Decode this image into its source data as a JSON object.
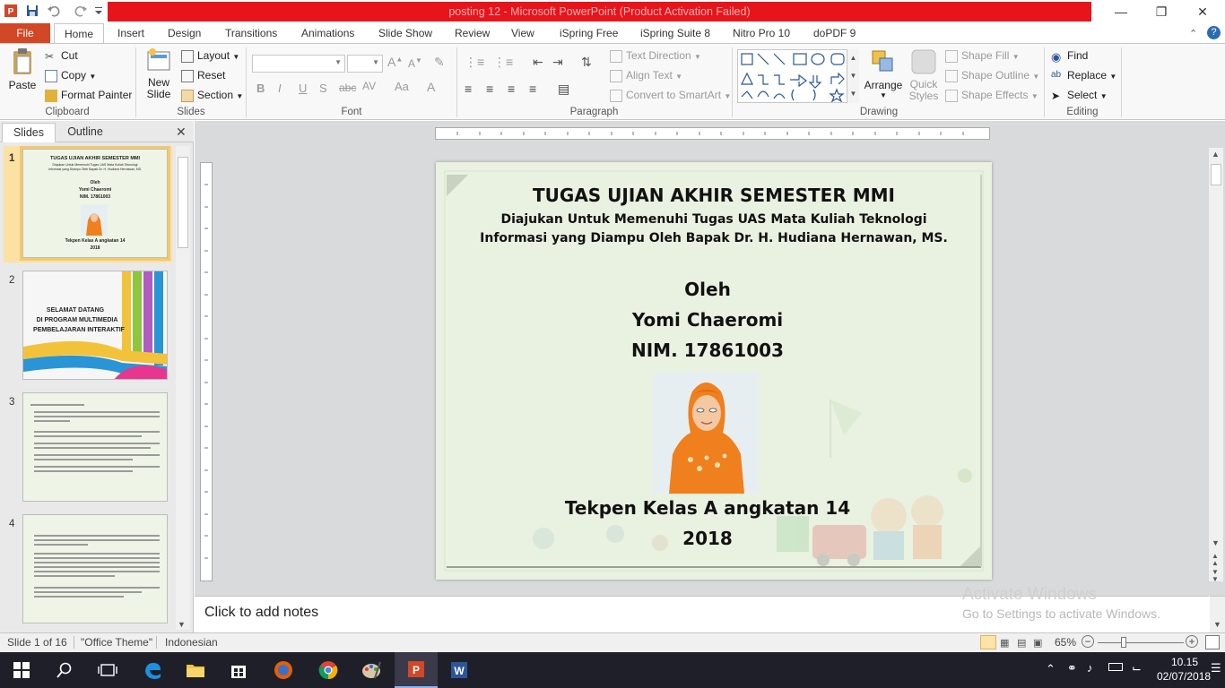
{
  "window": {
    "title": "posting 12 - Microsoft PowerPoint (Product Activation Failed)"
  },
  "tabs": [
    "File",
    "Home",
    "Insert",
    "Design",
    "Transitions",
    "Animations",
    "Slide Show",
    "Review",
    "View",
    "iSpring Free",
    "iSpring Suite 8",
    "Nitro Pro 10",
    "doPDF 9"
  ],
  "ribbon": {
    "clipboard": {
      "paste": "Paste",
      "cut": "Cut",
      "copy": "Copy",
      "format_painter": "Format Painter",
      "label": "Clipboard"
    },
    "slides": {
      "new_slide": "New",
      "new_slide2": "Slide",
      "layout": "Layout",
      "reset": "Reset",
      "section": "Section",
      "label": "Slides"
    },
    "font": {
      "label": "Font"
    },
    "paragraph": {
      "text_direction": "Text Direction",
      "align_text": "Align Text",
      "convert": "Convert to SmartArt",
      "label": "Paragraph"
    },
    "drawing": {
      "arrange": "Arrange",
      "quick_styles": "Quick",
      "quick_styles2": "Styles",
      "shape_fill": "Shape Fill",
      "shape_outline": "Shape Outline",
      "shape_effects": "Shape Effects",
      "label": "Drawing"
    },
    "editing": {
      "find": "Find",
      "replace": "Replace",
      "select": "Select",
      "label": "Editing"
    }
  },
  "pane": {
    "tabs": [
      "Slides",
      "Outline"
    ],
    "slides": [
      {
        "num": "1",
        "title": "TUGAS UJIAN AKHIR SEMESTER MMI",
        "line1": "Diajukan Untuk Memenuhi Tugas UAS Mata Kuliah Teknologi",
        "line2": "Informasi yang Diampu Oleh Bapak Dr. H. Hudiana Hernawan, MS.",
        "oleh": "Oleh",
        "name": "Yomi Chaeromi",
        "nim": "NIM. 17861003",
        "kelas": "Tekpen Kelas A angkatan 14",
        "year": "2018"
      },
      {
        "num": "2",
        "line1": "SELAMAT DATANG",
        "line2": "DI PROGRAM MULTIMEDIA",
        "line3": "PEMBELAJARAN INTERAKTIF"
      },
      {
        "num": "3"
      },
      {
        "num": "4"
      }
    ]
  },
  "slide": {
    "title": "TUGAS UJIAN AKHIR SEMESTER MMI",
    "subtitle1": "Diajukan Untuk Memenuhi Tugas UAS Mata Kuliah Teknologi",
    "subtitle2": "Informasi yang Diampu Oleh Bapak Dr. H. Hudiana Hernawan, MS.",
    "oleh": "Oleh",
    "name": "Yomi Chaeromi",
    "nim": "NIM. 17861003",
    "kelas": "Tekpen Kelas A angkatan 14",
    "year": "2018"
  },
  "notes": {
    "placeholder": "Click to add notes",
    "watermark1": "Activate Windows",
    "watermark2": "Go to Settings to activate Windows."
  },
  "status": {
    "slide_info": "Slide 1 of 16",
    "theme": "\"Office Theme\"",
    "language": "Indonesian",
    "zoom": "65%"
  },
  "taskbar": {
    "time": "10.15",
    "date": "02/07/2018"
  },
  "colors": {
    "file_tab": "#d24726",
    "title_bar_red": "#e8141b",
    "slide_bg": "#e9f1e0"
  }
}
